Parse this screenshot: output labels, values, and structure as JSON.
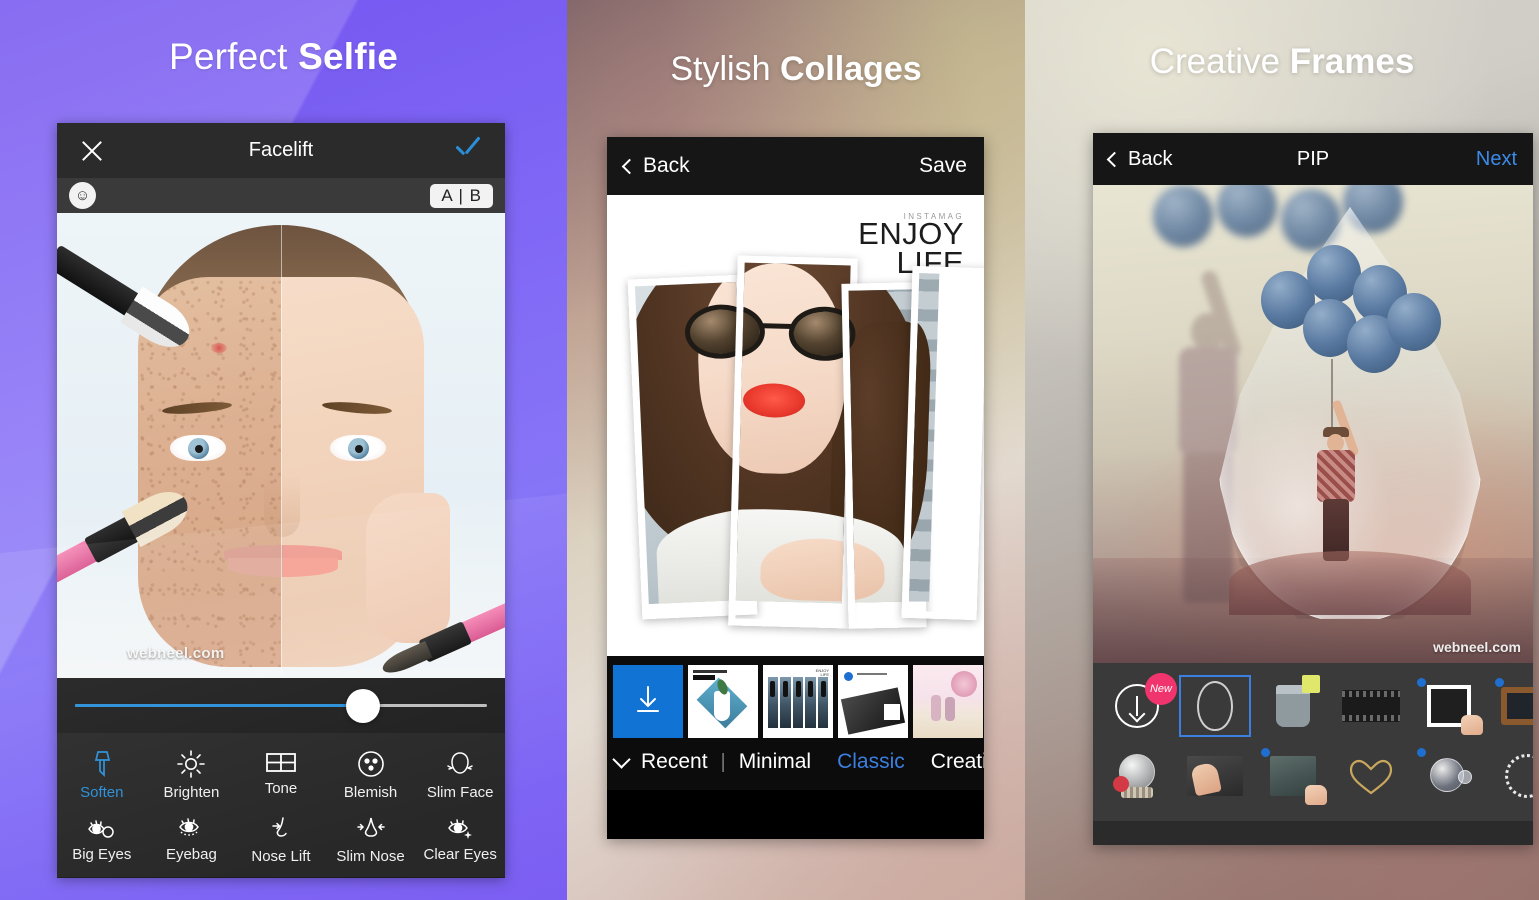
{
  "panels": [
    {
      "headline_light": "Perfect ",
      "headline_bold": "Selfie",
      "nav": {
        "close_icon": "close-icon",
        "title": "Facelift",
        "confirm_icon": "check-icon"
      },
      "subbar": {
        "face_icon": "face-icon",
        "compare_label": "A | B",
        "compare_a": "A",
        "compare_b": "B"
      },
      "watermark": "webneel.com",
      "slider": {
        "value_percent": 70
      },
      "tools_row1": [
        {
          "label": "Soften",
          "icon": "soften-brush-icon",
          "active": true
        },
        {
          "label": "Brighten",
          "icon": "sun-icon",
          "active": false
        },
        {
          "label": "Tone",
          "icon": "tone-grid-icon",
          "active": false
        },
        {
          "label": "Blemish",
          "icon": "blemish-circle-icon",
          "active": false
        },
        {
          "label": "Slim Face",
          "icon": "slim-face-icon",
          "active": false
        }
      ],
      "tools_row2": [
        {
          "label": "Big Eyes",
          "icon": "big-eyes-icon",
          "active": false
        },
        {
          "label": "Eyebag",
          "icon": "eyebag-icon",
          "active": false
        },
        {
          "label": "Nose Lift",
          "icon": "nose-lift-icon",
          "active": false
        },
        {
          "label": "Slim Nose",
          "icon": "slim-nose-icon",
          "active": false
        },
        {
          "label": "Clear Eyes",
          "icon": "clear-eyes-icon",
          "active": false
        }
      ]
    },
    {
      "headline_light": "Stylish ",
      "headline_bold": "Collages",
      "nav": {
        "back_label": "Back",
        "back_icon": "chevron-left-icon",
        "save_label": "Save"
      },
      "collage": {
        "brand": "INSTAMAG",
        "line1": "ENJOY",
        "line2": "LIFE"
      },
      "thumbnails": [
        {
          "name": "download-templates",
          "icon": "download-icon",
          "selected": false
        },
        {
          "name": "template-minimal-vase",
          "selected": false
        },
        {
          "name": "template-classic-enjoy-life",
          "selected": true
        },
        {
          "name": "template-bw-photo",
          "selected": false
        },
        {
          "name": "template-pink-couple",
          "selected": false
        }
      ],
      "tabs": [
        {
          "label": "Recent",
          "active": false
        },
        {
          "label": "Minimal",
          "active": false
        },
        {
          "label": "Classic",
          "active": true
        },
        {
          "label": "Creative",
          "active": false
        }
      ],
      "tab_separator": "|",
      "expand_icon": "chevron-down-icon"
    },
    {
      "headline_light": "Creative ",
      "headline_bold": "Frames",
      "nav": {
        "back_label": "Back",
        "back_icon": "chevron-left-icon",
        "title": "PIP",
        "next_label": "Next"
      },
      "watermark": "webneel.com",
      "frames_row1": [
        {
          "name": "download-frames",
          "icon": "download-icon",
          "badge": "New",
          "selected": false
        },
        {
          "name": "frame-water-drop",
          "icon": "water-drop-icon",
          "selected": true
        },
        {
          "name": "frame-glass",
          "icon": "glass-icon",
          "selected": false
        },
        {
          "name": "frame-film-strip",
          "icon": "film-strip-icon",
          "selected": false
        },
        {
          "name": "frame-polaroid",
          "icon": "polaroid-icon",
          "selected": false
        },
        {
          "name": "frame-tv",
          "icon": "tv-icon",
          "selected": false
        }
      ],
      "frames_row2": [
        {
          "name": "frame-snow-globe",
          "icon": "snow-globe-icon",
          "selected": false
        },
        {
          "name": "frame-hands",
          "icon": "hands-icon",
          "selected": false
        },
        {
          "name": "frame-screen",
          "icon": "screen-icon",
          "selected": false
        },
        {
          "name": "frame-heart",
          "icon": "heart-icon",
          "selected": false
        },
        {
          "name": "frame-bubble",
          "icon": "bubble-icon",
          "selected": false
        },
        {
          "name": "frame-snowflake-ring",
          "icon": "snowflake-ring-icon",
          "selected": false
        }
      ]
    }
  ],
  "colors": {
    "panel1_bg": "#8b74f7",
    "accent_blue": "#2a8fd8",
    "tab_active_blue": "#3b7fe0",
    "badge_pink": "#f0356e",
    "toolbar_dark": "#282828",
    "nav_dark": "#161616"
  }
}
